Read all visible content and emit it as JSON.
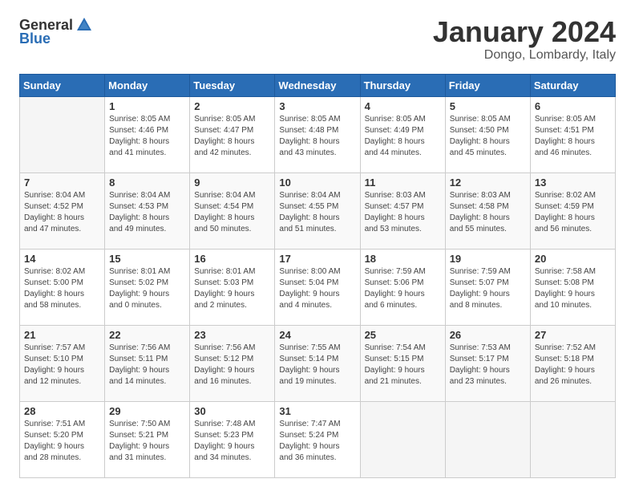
{
  "header": {
    "logo_general": "General",
    "logo_blue": "Blue",
    "month_title": "January 2024",
    "location": "Dongo, Lombardy, Italy"
  },
  "days_of_week": [
    "Sunday",
    "Monday",
    "Tuesday",
    "Wednesday",
    "Thursday",
    "Friday",
    "Saturday"
  ],
  "weeks": [
    [
      {
        "day": "",
        "info": ""
      },
      {
        "day": "1",
        "info": "Sunrise: 8:05 AM\nSunset: 4:46 PM\nDaylight: 8 hours\nand 41 minutes."
      },
      {
        "day": "2",
        "info": "Sunrise: 8:05 AM\nSunset: 4:47 PM\nDaylight: 8 hours\nand 42 minutes."
      },
      {
        "day": "3",
        "info": "Sunrise: 8:05 AM\nSunset: 4:48 PM\nDaylight: 8 hours\nand 43 minutes."
      },
      {
        "day": "4",
        "info": "Sunrise: 8:05 AM\nSunset: 4:49 PM\nDaylight: 8 hours\nand 44 minutes."
      },
      {
        "day": "5",
        "info": "Sunrise: 8:05 AM\nSunset: 4:50 PM\nDaylight: 8 hours\nand 45 minutes."
      },
      {
        "day": "6",
        "info": "Sunrise: 8:05 AM\nSunset: 4:51 PM\nDaylight: 8 hours\nand 46 minutes."
      }
    ],
    [
      {
        "day": "7",
        "info": "Sunrise: 8:04 AM\nSunset: 4:52 PM\nDaylight: 8 hours\nand 47 minutes."
      },
      {
        "day": "8",
        "info": "Sunrise: 8:04 AM\nSunset: 4:53 PM\nDaylight: 8 hours\nand 49 minutes."
      },
      {
        "day": "9",
        "info": "Sunrise: 8:04 AM\nSunset: 4:54 PM\nDaylight: 8 hours\nand 50 minutes."
      },
      {
        "day": "10",
        "info": "Sunrise: 8:04 AM\nSunset: 4:55 PM\nDaylight: 8 hours\nand 51 minutes."
      },
      {
        "day": "11",
        "info": "Sunrise: 8:03 AM\nSunset: 4:57 PM\nDaylight: 8 hours\nand 53 minutes."
      },
      {
        "day": "12",
        "info": "Sunrise: 8:03 AM\nSunset: 4:58 PM\nDaylight: 8 hours\nand 55 minutes."
      },
      {
        "day": "13",
        "info": "Sunrise: 8:02 AM\nSunset: 4:59 PM\nDaylight: 8 hours\nand 56 minutes."
      }
    ],
    [
      {
        "day": "14",
        "info": "Sunrise: 8:02 AM\nSunset: 5:00 PM\nDaylight: 8 hours\nand 58 minutes."
      },
      {
        "day": "15",
        "info": "Sunrise: 8:01 AM\nSunset: 5:02 PM\nDaylight: 9 hours\nand 0 minutes."
      },
      {
        "day": "16",
        "info": "Sunrise: 8:01 AM\nSunset: 5:03 PM\nDaylight: 9 hours\nand 2 minutes."
      },
      {
        "day": "17",
        "info": "Sunrise: 8:00 AM\nSunset: 5:04 PM\nDaylight: 9 hours\nand 4 minutes."
      },
      {
        "day": "18",
        "info": "Sunrise: 7:59 AM\nSunset: 5:06 PM\nDaylight: 9 hours\nand 6 minutes."
      },
      {
        "day": "19",
        "info": "Sunrise: 7:59 AM\nSunset: 5:07 PM\nDaylight: 9 hours\nand 8 minutes."
      },
      {
        "day": "20",
        "info": "Sunrise: 7:58 AM\nSunset: 5:08 PM\nDaylight: 9 hours\nand 10 minutes."
      }
    ],
    [
      {
        "day": "21",
        "info": "Sunrise: 7:57 AM\nSunset: 5:10 PM\nDaylight: 9 hours\nand 12 minutes."
      },
      {
        "day": "22",
        "info": "Sunrise: 7:56 AM\nSunset: 5:11 PM\nDaylight: 9 hours\nand 14 minutes."
      },
      {
        "day": "23",
        "info": "Sunrise: 7:56 AM\nSunset: 5:12 PM\nDaylight: 9 hours\nand 16 minutes."
      },
      {
        "day": "24",
        "info": "Sunrise: 7:55 AM\nSunset: 5:14 PM\nDaylight: 9 hours\nand 19 minutes."
      },
      {
        "day": "25",
        "info": "Sunrise: 7:54 AM\nSunset: 5:15 PM\nDaylight: 9 hours\nand 21 minutes."
      },
      {
        "day": "26",
        "info": "Sunrise: 7:53 AM\nSunset: 5:17 PM\nDaylight: 9 hours\nand 23 minutes."
      },
      {
        "day": "27",
        "info": "Sunrise: 7:52 AM\nSunset: 5:18 PM\nDaylight: 9 hours\nand 26 minutes."
      }
    ],
    [
      {
        "day": "28",
        "info": "Sunrise: 7:51 AM\nSunset: 5:20 PM\nDaylight: 9 hours\nand 28 minutes."
      },
      {
        "day": "29",
        "info": "Sunrise: 7:50 AM\nSunset: 5:21 PM\nDaylight: 9 hours\nand 31 minutes."
      },
      {
        "day": "30",
        "info": "Sunrise: 7:48 AM\nSunset: 5:23 PM\nDaylight: 9 hours\nand 34 minutes."
      },
      {
        "day": "31",
        "info": "Sunrise: 7:47 AM\nSunset: 5:24 PM\nDaylight: 9 hours\nand 36 minutes."
      },
      {
        "day": "",
        "info": ""
      },
      {
        "day": "",
        "info": ""
      },
      {
        "day": "",
        "info": ""
      }
    ]
  ]
}
